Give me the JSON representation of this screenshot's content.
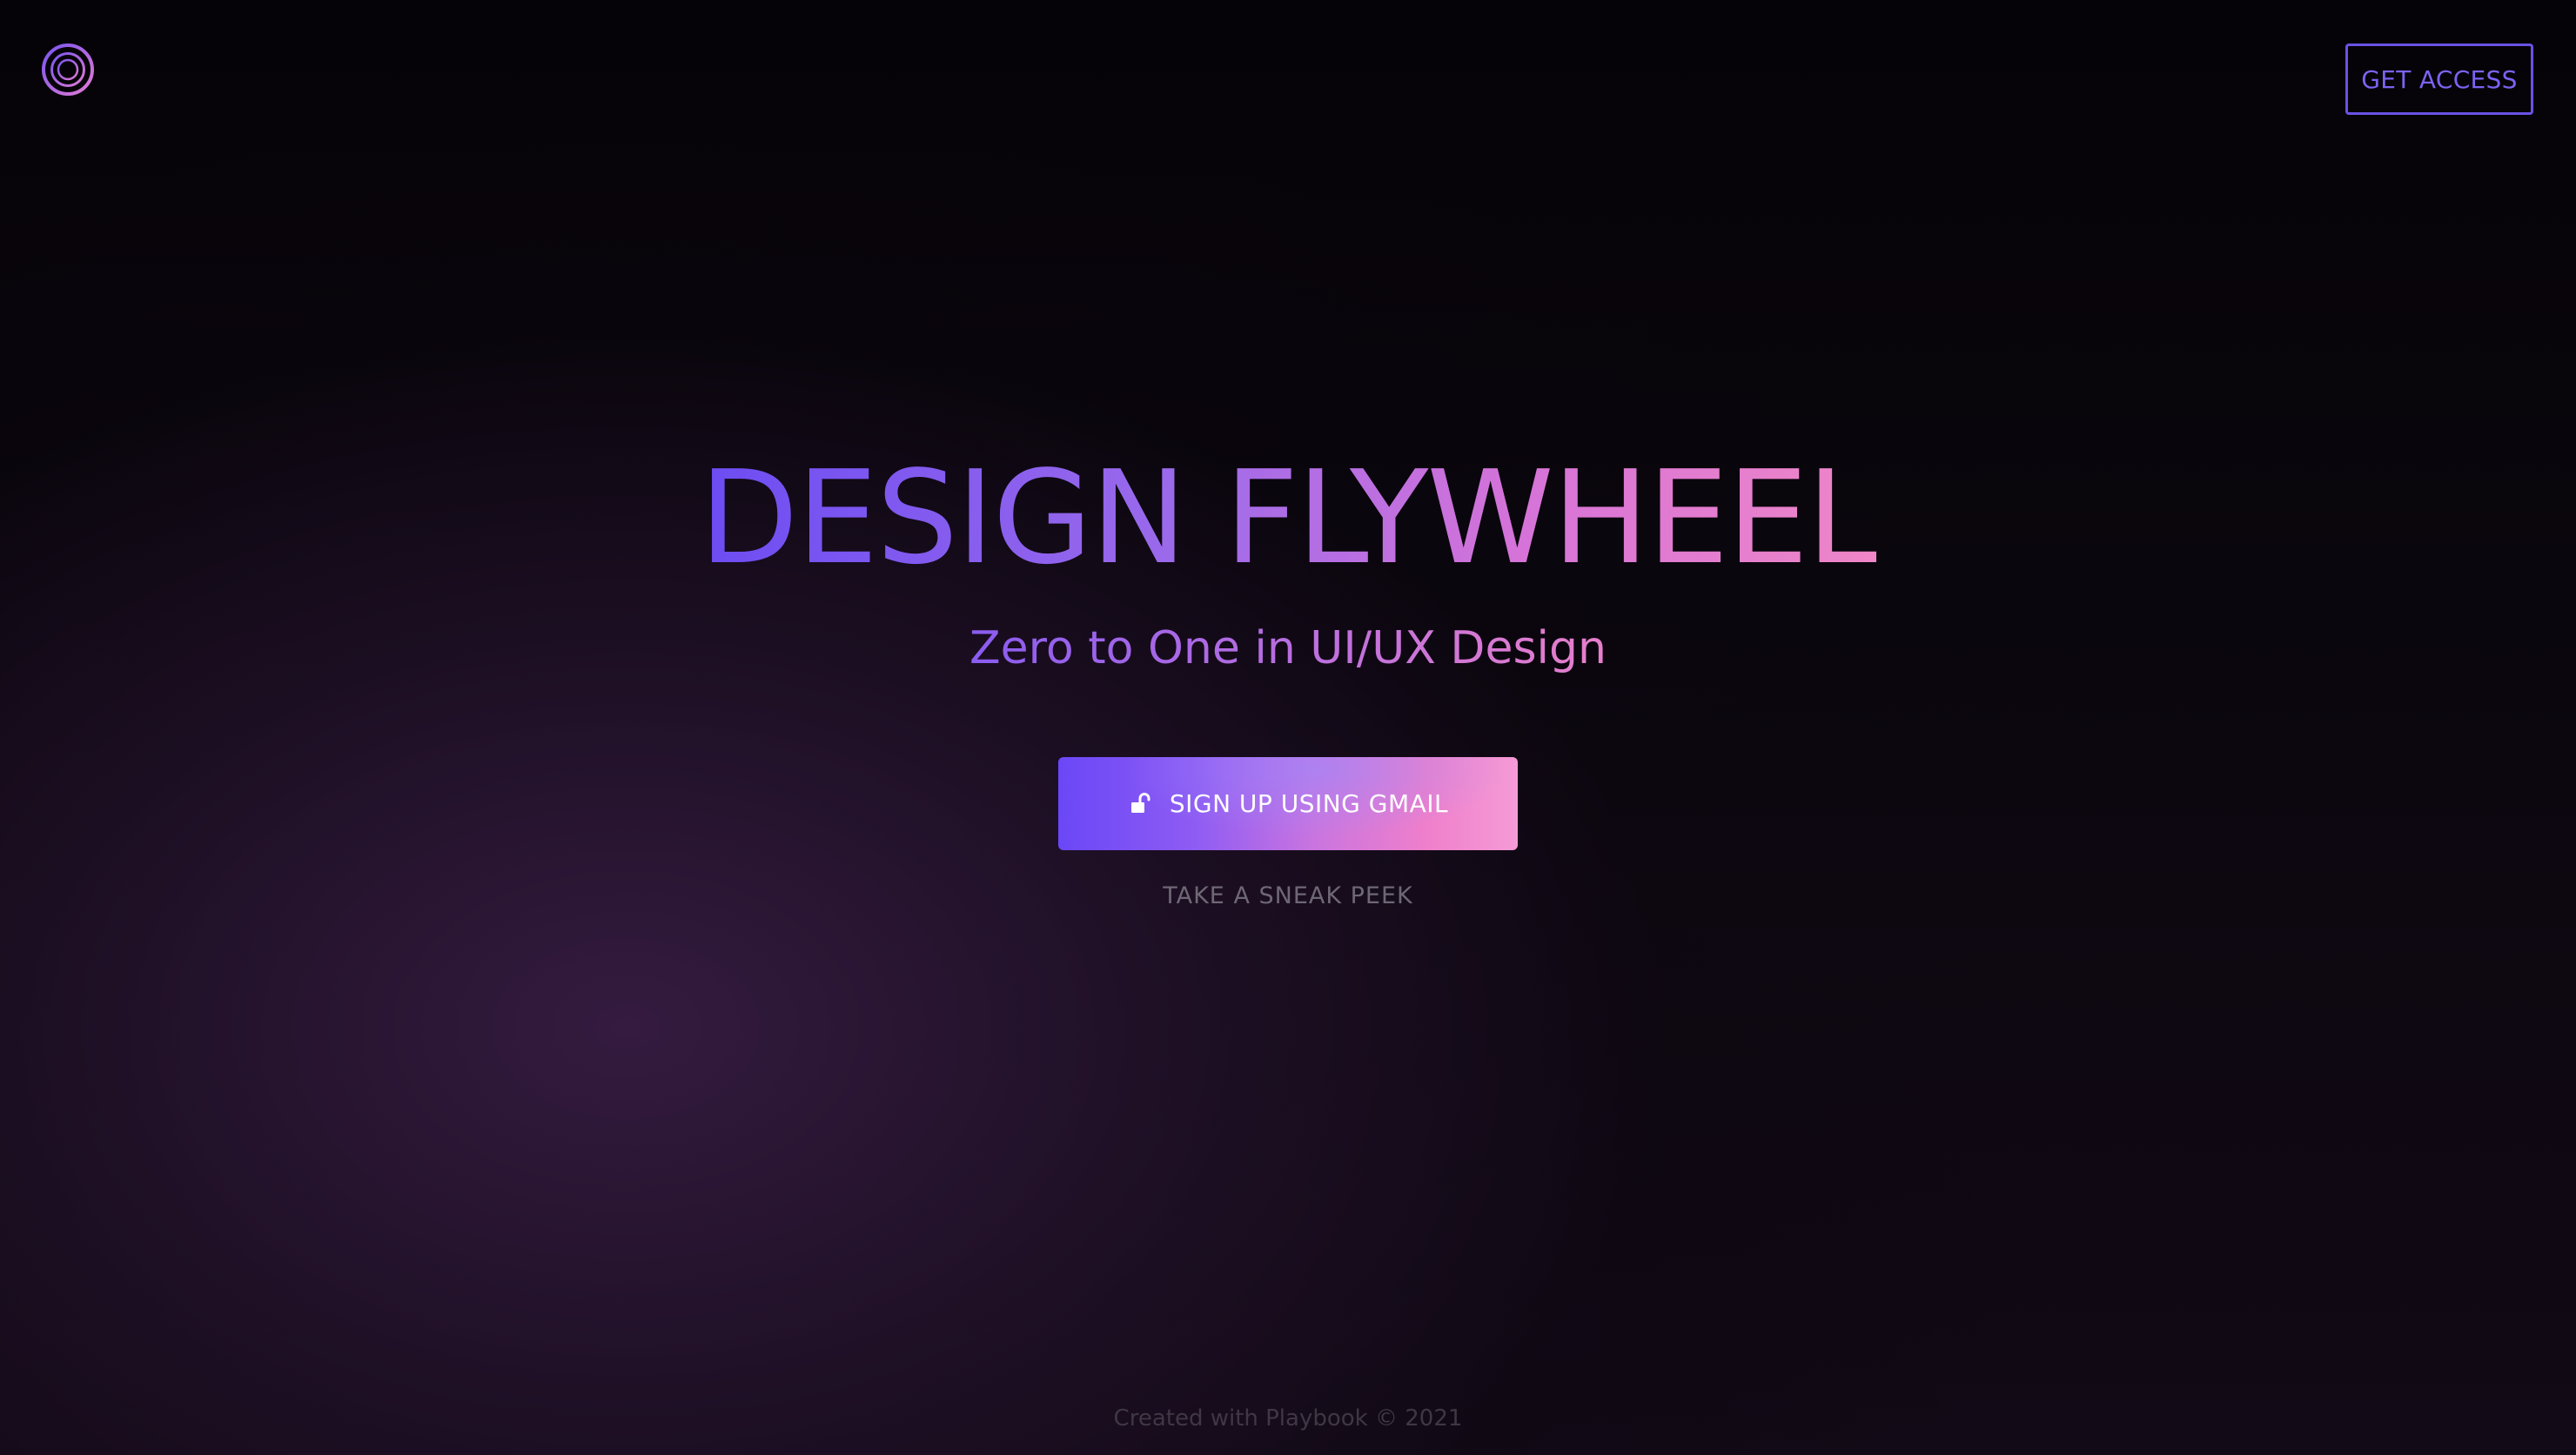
{
  "header": {
    "logo_icon": "concentric-circles-logo-icon",
    "get_access_label": "GET ACCESS"
  },
  "hero": {
    "title": "DESIGN FLYWHEEL",
    "subtitle": "Zero to One in UI/UX Design",
    "signup_button": {
      "icon": "unlock-icon",
      "label": "SIGN UP USING GMAIL"
    },
    "sneak_peek_label": "TAKE A SNEAK PEEK"
  },
  "footer": {
    "text": "Created with Playbook © 2021"
  },
  "colors": {
    "background": "#040205",
    "accent_purple": "#6a52e6",
    "accent_pink": "#ef86c7",
    "muted_text": "#6e6775"
  }
}
